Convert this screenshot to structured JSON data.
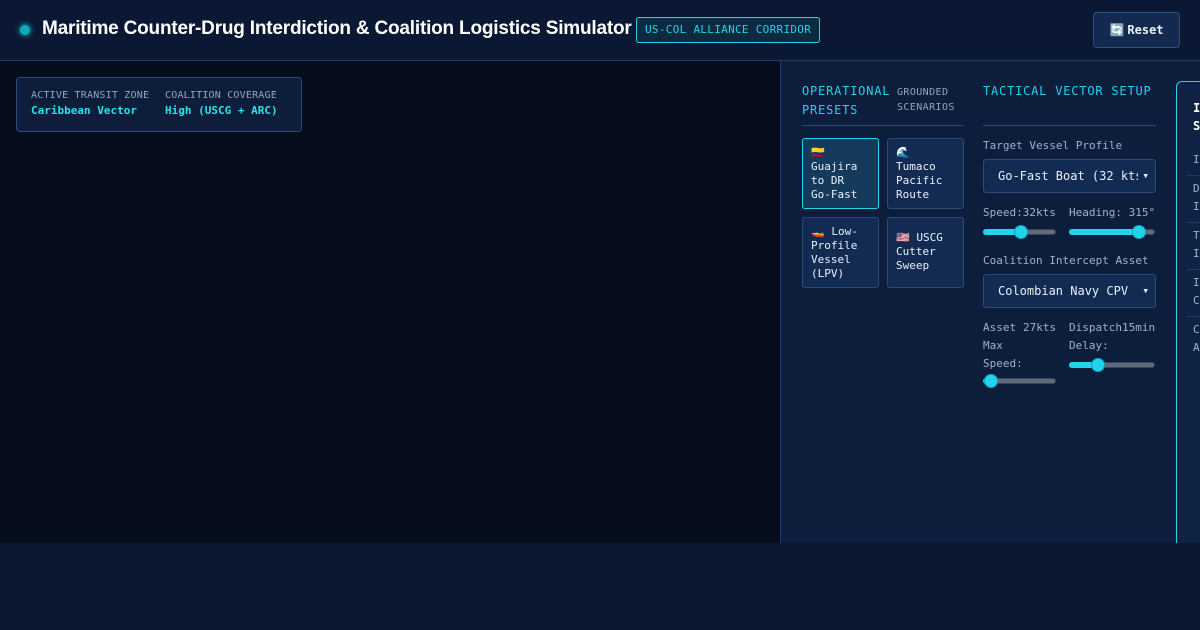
{
  "header": {
    "title": "Maritime Counter-Drug Interdiction & Coalition Logistics Simulator",
    "badge": "US-COL ALLIANCE CORRIDOR",
    "reset_icon": "🔄",
    "reset_label": "Reset"
  },
  "map": {
    "zone_label": "ACTIVE TRANSIT ZONE",
    "zone_value": "Caribbean Vector",
    "coverage_label": "COALITION COVERAGE",
    "coverage_value": "High (USCG + ARC)"
  },
  "presets": {
    "title": "OPERATIONAL PRESETS",
    "subtitle": "GROUNDED SCENARIOS",
    "items": [
      {
        "icon": "🇨🇴",
        "label": "Guajira to DR Go-Fast",
        "active": true
      },
      {
        "icon": "🌊",
        "label": "Tumaco Pacific Route",
        "active": false
      },
      {
        "icon": "🚤",
        "label": "Low-Profile Vessel (LPV)",
        "active": false
      },
      {
        "icon": "🇺🇸",
        "label": "USCG Cutter Sweep",
        "active": false
      }
    ]
  },
  "vector": {
    "title": "TACTICAL VECTOR SETUP",
    "vessel_label": "Target Vessel Profile",
    "vessel_value": "Go-Fast Boat (32 kts)",
    "speed_label": "Speed:",
    "speed_value": "32kts",
    "speed_level": 0.52,
    "heading_label": "Heading:",
    "heading_value": "315°",
    "heading_level": 0.88,
    "asset_label": "Coalition Intercept Asset",
    "asset_value": "Colombian Navy CPV",
    "asset_speed_label": "Asset Max Speed:",
    "asset_speed_value": "27kts",
    "asset_speed_level": 0.02,
    "dispatch_label": "Dispatch Delay:",
    "dispatch_value": "15min",
    "dispatch_level": 0.3
  },
  "sim": {
    "title": "I S",
    "rows": [
      "I",
      "D I",
      "T I",
      "I C",
      "C A"
    ]
  },
  "colors": {
    "accent": "#22d3ee",
    "background": "#0a1730",
    "map": "#050d1d",
    "panel": "#0d1e3c"
  }
}
